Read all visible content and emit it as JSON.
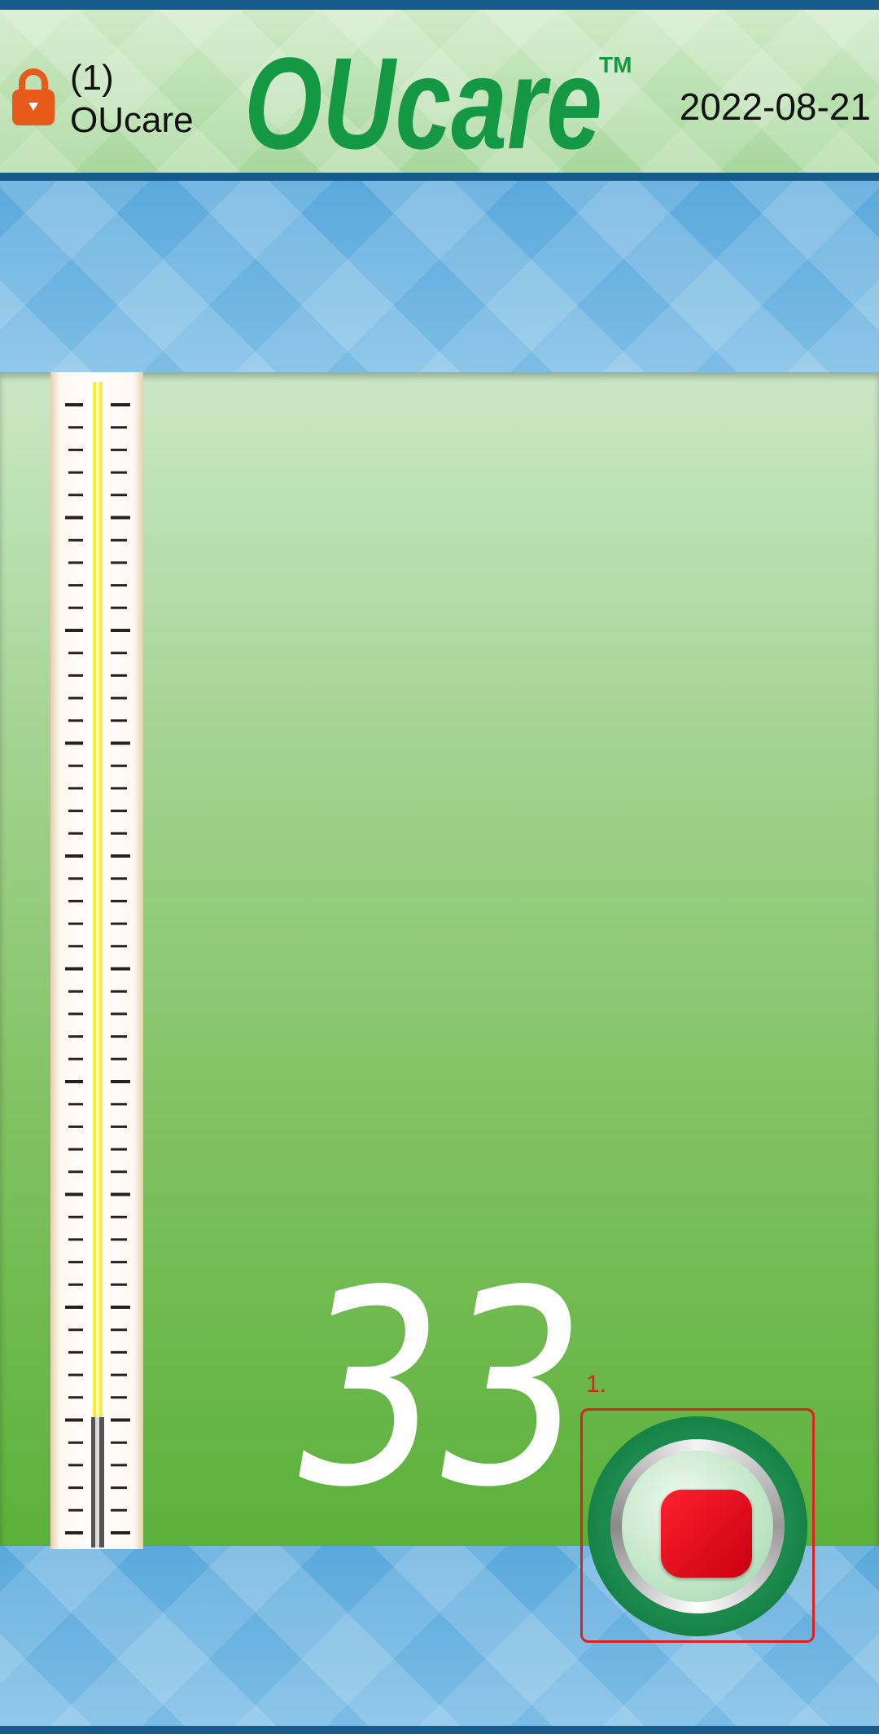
{
  "header": {
    "user_count": "(1)",
    "user_name": "OUcare",
    "logo_text": "OUcare",
    "trademark": "TM",
    "date": "2022-08-21"
  },
  "reading": {
    "value": "33"
  },
  "controls": {
    "annotation_label": "1."
  },
  "colors": {
    "brand_green": "#159844",
    "header_border": "#155a8a",
    "stop_red": "#e0101e",
    "lock_orange": "#e8591a"
  },
  "icons": {
    "lock": "lock-icon",
    "stop": "stop-icon"
  }
}
